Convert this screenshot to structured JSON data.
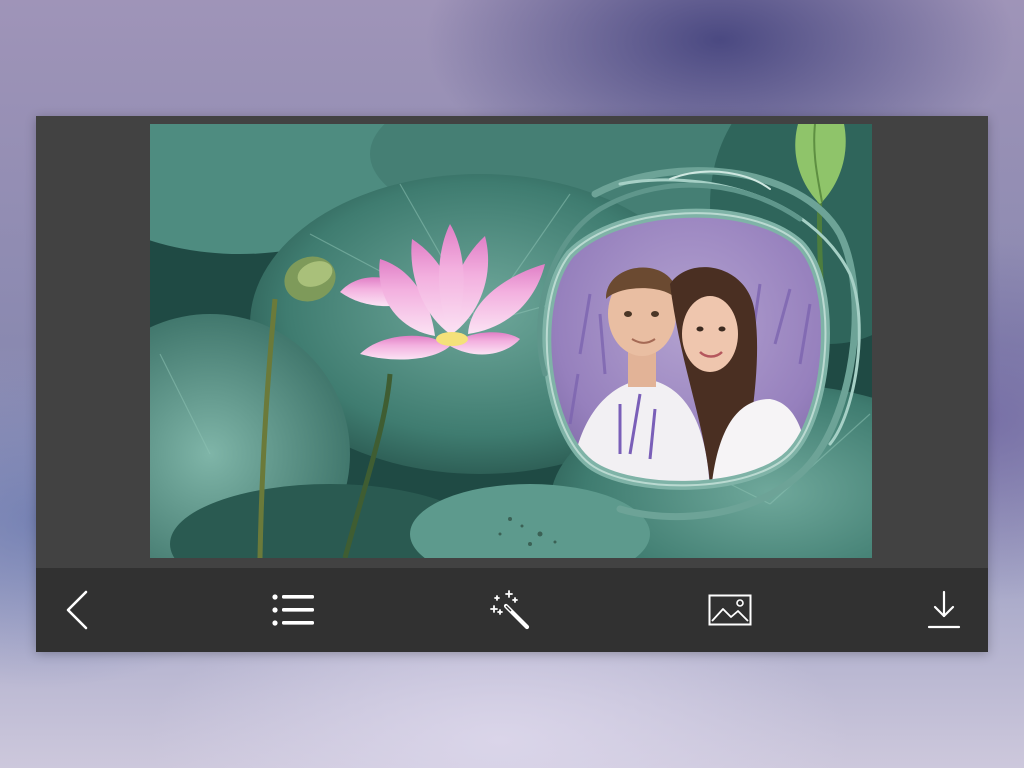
{
  "toolbar": {
    "items": [
      {
        "name": "back",
        "icon": "chevron-left-icon"
      },
      {
        "name": "frames",
        "icon": "list-icon"
      },
      {
        "name": "effects",
        "icon": "magic-wand-icon"
      },
      {
        "name": "gallery",
        "icon": "image-icon"
      },
      {
        "name": "save",
        "icon": "download-icon"
      }
    ]
  },
  "preview": {
    "frame_theme": "lotus-flower-frame",
    "photo_subject": "couple-photo"
  },
  "colors": {
    "panel_bg": "#424242",
    "toolbar_bg": "#313131",
    "icon_color": "#ffffff",
    "leaf_green": "#3f7a70",
    "lotus_pink": "#f2a7dc"
  }
}
